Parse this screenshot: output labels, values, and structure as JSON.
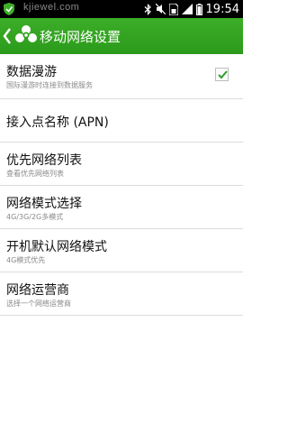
{
  "status_bar": {
    "watermark": "kjiewel.com",
    "time": "19:54"
  },
  "header": {
    "title": "移动网络设置",
    "back_icon": "chevron-left-icon",
    "app_icon": "network-settings-icon"
  },
  "settings": [
    {
      "title": "数据漫游",
      "subtitle": "国际漫游时连接到数据服务",
      "checked": true
    },
    {
      "title": "接入点名称 (APN)",
      "subtitle": ""
    },
    {
      "title": "优先网络列表",
      "subtitle": "查看优先网络列表"
    },
    {
      "title": "网络模式选择",
      "subtitle": "4G/3G/2G多模式"
    },
    {
      "title": "开机默认网络模式",
      "subtitle": "4G模式优先"
    },
    {
      "title": "网络运营商",
      "subtitle": "选择一个网络运营商"
    }
  ],
  "colors": {
    "header": "#2fa01f",
    "check": "#2e9e2a"
  }
}
